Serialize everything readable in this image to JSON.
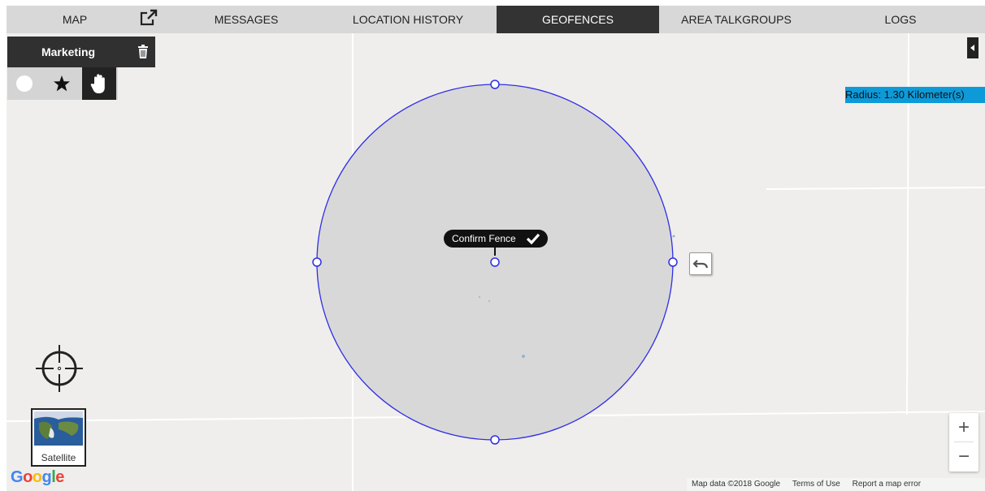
{
  "nav": {
    "tabs": [
      {
        "label": "MAP",
        "active": false
      },
      {
        "label": "MESSAGES",
        "active": false
      },
      {
        "label": "LOCATION HISTORY",
        "active": false
      },
      {
        "label": "GEOFENCES",
        "active": true
      },
      {
        "label": "AREA TALKGROUPS",
        "active": false
      },
      {
        "label": "LOGS",
        "active": false
      }
    ],
    "popout_icon": "external-link-icon",
    "active_color": "#333333"
  },
  "geofence": {
    "name": "Marketing",
    "delete_icon": "trash-icon",
    "tools": [
      {
        "icon": "circle-icon",
        "active": false
      },
      {
        "icon": "star-icon",
        "active": false
      },
      {
        "icon": "hand-icon",
        "active": true
      }
    ],
    "radius_text": "Radius: 1.30 Kilometer(s)",
    "confirm_label": "Confirm Fence",
    "fence_color": "#2f2fe6",
    "radius_bg": "#0e9ad8"
  },
  "map": {
    "satellite_label": "Satellite",
    "google_logo": "Google",
    "zoom_in": "+",
    "zoom_out": "−",
    "attribution": "Map data ©2018 Google",
    "terms": "Terms of Use",
    "report": "Report a map error"
  }
}
